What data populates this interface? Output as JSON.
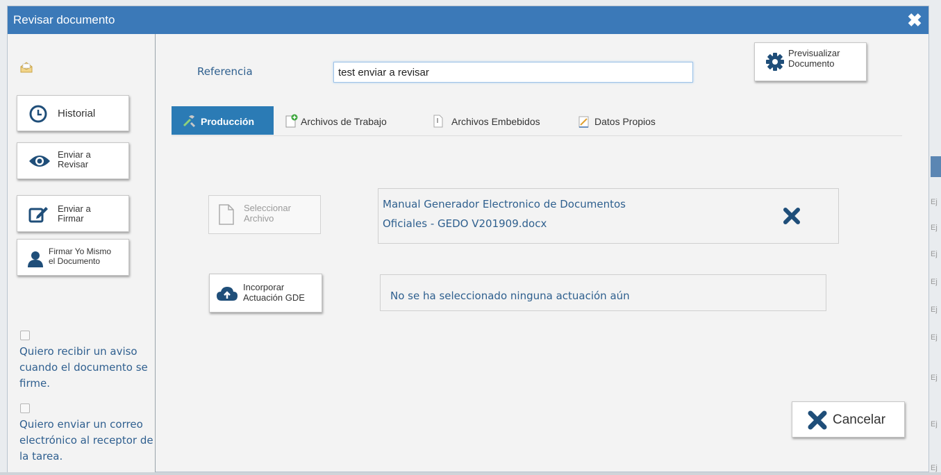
{
  "dialog": {
    "title": "Revisar documento",
    "close_icon": "close-x-icon"
  },
  "left": {
    "historial_label": "Historial",
    "enviar_revisar_label": [
      "Enviar a",
      "Revisar"
    ],
    "enviar_firmar_label": [
      "Enviar a",
      "Firmar"
    ],
    "firmar_yo_label": [
      "Firmar Yo Mismo",
      "el Documento"
    ],
    "check_aviso_label": "Quiero recibir un aviso cuando el documento se firme.",
    "check_correo_label": "Quiero enviar un correo electrónico al receptor de la tarea.",
    "check_aviso_checked": false,
    "check_correo_checked": false
  },
  "main": {
    "referencia_label": "Referencia",
    "referencia_value": "test enviar a revisar",
    "previsualizar_label": [
      "Previsualizar",
      "Documento"
    ],
    "tabs": [
      {
        "label": "Producción",
        "active": true,
        "icon": "tools-icon"
      },
      {
        "label": "Archivos de Trabajo",
        "active": false,
        "icon": "file-add-icon"
      },
      {
        "label": "Archivos Embebidos",
        "active": false,
        "icon": "attachment-icon"
      },
      {
        "label": "Datos Propios",
        "active": false,
        "icon": "edit-doc-icon"
      }
    ],
    "seleccionar_label": [
      "Seleccionar",
      "Archivo"
    ],
    "file_name_lines": [
      "Manual Generador Electronico de Documentos",
      "Oficiales - GEDO V201909.docx"
    ],
    "incorporar_label": [
      "Incorporar",
      "Actuación GDE"
    ],
    "actuacion_text": "No se ha seleccionado ninguna actuación aún",
    "cancelar_label": "Cancelar"
  },
  "background": {
    "cells": [
      "Ej",
      "Ej",
      "Ej",
      "Ej",
      "Ej",
      "Ej",
      "Ej",
      "Ej",
      "Ej"
    ]
  },
  "colors": {
    "titlebar": "#3b79b8",
    "active_tab": "#2b7bb5",
    "icon_dark_blue": "#1f4e79",
    "link_text": "#2e5f8e"
  }
}
